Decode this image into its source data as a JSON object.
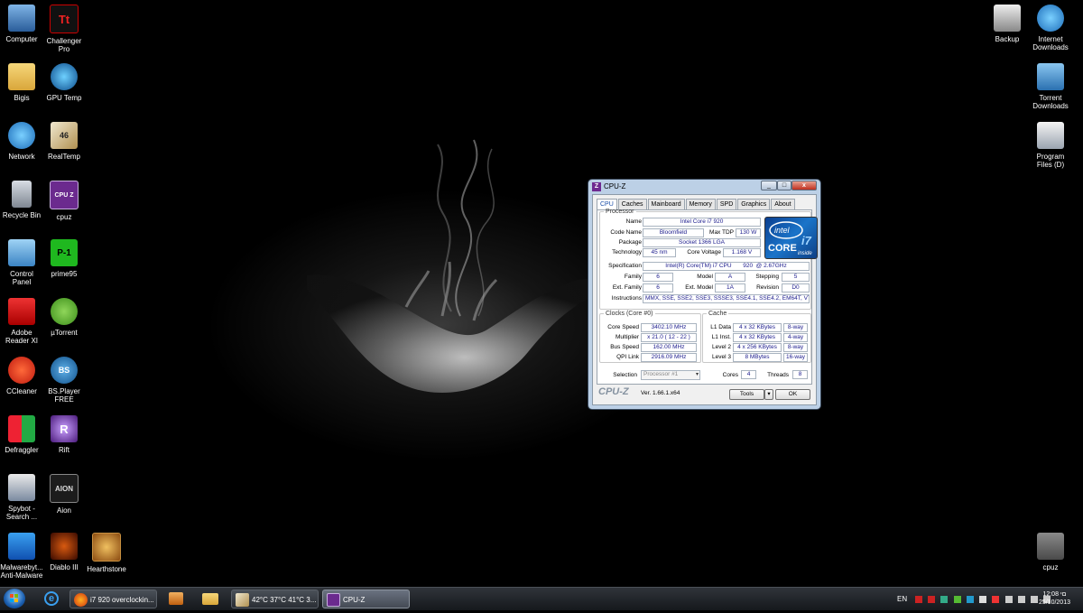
{
  "desktop": {
    "icons_left": [
      {
        "label": "Computer"
      },
      {
        "label": "Challenger Pro"
      },
      {
        "label": "Bigis"
      },
      {
        "label": "GPU Temp"
      },
      {
        "label": "Network"
      },
      {
        "label": "RealTemp"
      },
      {
        "label": "Recycle Bin"
      },
      {
        "label": "cpuz"
      },
      {
        "label": "Control Panel"
      },
      {
        "label": "prime95"
      },
      {
        "label": "Adobe Reader XI"
      },
      {
        "label": "µTorrent"
      },
      {
        "label": "CCleaner"
      },
      {
        "label": "BS.Player FREE"
      },
      {
        "label": "Defraggler"
      },
      {
        "label": "Rift"
      },
      {
        "label": "Spybot - Search ..."
      },
      {
        "label": "Aion"
      },
      {
        "label": "Malwarebyt... Anti-Malware"
      },
      {
        "label": "Diablo III"
      },
      {
        "label": "Hearthstone"
      }
    ],
    "icons_right": [
      {
        "label": "Backup"
      },
      {
        "label": "Internet Downloads"
      },
      {
        "label": "Torrent Downloads"
      },
      {
        "label": "Program Files (D)"
      },
      {
        "label": "cpuz"
      }
    ],
    "glyphs": {
      "challenger": "Tt",
      "cpuz": "CPU Z",
      "prime95": "P-1",
      "aion": "AION",
      "rift": "R",
      "bsplayer": "BS",
      "realtemp": "46"
    }
  },
  "cpuz": {
    "title": "CPU-Z",
    "window_buttons": {
      "min": "_",
      "max": "□",
      "close": "x"
    },
    "tabs": [
      "CPU",
      "Caches",
      "Mainboard",
      "Memory",
      "SPD",
      "Graphics",
      "About"
    ],
    "active_tab": "CPU",
    "processor": {
      "legend": "Processor",
      "name_label": "Name",
      "name": "Intel Core i7 920",
      "codename_label": "Code Name",
      "codename": "Bloomfield",
      "maxtdp_label": "Max TDP",
      "maxtdp": "130 W",
      "package_label": "Package",
      "package": "Socket 1366 LGA",
      "technology_label": "Technology",
      "technology": "45 nm",
      "corevoltage_label": "Core Voltage",
      "corevoltage": "1.168 V",
      "spec_label": "Specification",
      "spec": "Intel(R) Core(TM) i7 CPU       920  @ 2.67GHz",
      "family_label": "Family",
      "family": "6",
      "model_label": "Model",
      "model": "A",
      "stepping_label": "Stepping",
      "stepping": "5",
      "extfamily_label": "Ext. Family",
      "extfamily": "6",
      "extmodel_label": "Ext. Model",
      "extmodel": "1A",
      "revision_label": "Revision",
      "revision": "D0",
      "instructions_label": "Instructions",
      "instructions": "MMX, SSE, SSE2, SSE3, SSSE3, SSE4.1, SSE4.2, EM64T, VT-x"
    },
    "logo": {
      "brand": "intel",
      "line": "CORE",
      "model": "i7",
      "inside": "inside"
    },
    "clocks": {
      "legend": "Clocks (Core #0)",
      "corespeed_label": "Core Speed",
      "corespeed": "3402.10 MHz",
      "multiplier_label": "Multiplier",
      "multiplier": "x 21.0 ( 12 - 22 )",
      "busspeed_label": "Bus Speed",
      "busspeed": "162.00 MHz",
      "qpi_label": "QPI Link",
      "qpi": "2916.09 MHz"
    },
    "cache": {
      "legend": "Cache",
      "l1d_label": "L1 Data",
      "l1d": "4 x 32 KBytes",
      "l1d_way": "8-way",
      "l1i_label": "L1 Inst.",
      "l1i": "4 x 32 KBytes",
      "l1i_way": "4-way",
      "l2_label": "Level 2",
      "l2": "4 x 256 KBytes",
      "l2_way": "8-way",
      "l3_label": "Level 3",
      "l3": "8 MBytes",
      "l3_way": "16-way"
    },
    "selection": {
      "label": "Selection",
      "value": "Processor #1"
    },
    "cores_label": "Cores",
    "cores": "4",
    "threads_label": "Threads",
    "threads": "8",
    "brand_text": "CPU-Z",
    "version": "Ver. 1.66.1.x64",
    "tools_label": "Tools",
    "ok_label": "OK"
  },
  "taskbar": {
    "buttons": [
      {
        "label": "i7 920 overclockin..."
      },
      {
        "label": "42°C 37°C 41°C 3..."
      },
      {
        "label": "CPU-Z"
      }
    ],
    "lang": "EN",
    "time": "12:08 םי",
    "date": "25/10/2013"
  },
  "colors": {
    "accent": "#1a4ea8",
    "value_text": "#1a1a8c",
    "cpuz_frame": "#bcd0e6"
  }
}
